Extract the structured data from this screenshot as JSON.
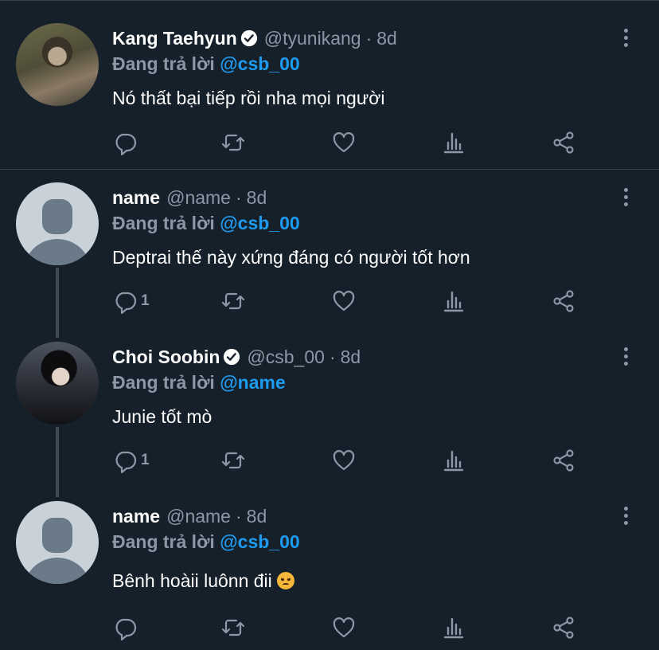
{
  "tweets": [
    {
      "name": "Kang Taehyun",
      "verified": true,
      "handle": "@tyunikang",
      "separator": "·",
      "time": "8d",
      "reply_label": "Đang trả lời",
      "reply_to": "@csb_00",
      "text": "Nó thất bại tiếp rồi nha mọi người",
      "reply_count": "",
      "avatar": "photo-avatar"
    },
    {
      "name": "name",
      "verified": false,
      "handle": "@name",
      "separator": "·",
      "time": "8d",
      "reply_label": "Đang trả lời",
      "reply_to": "@csb_00",
      "text": "Deptrai thế này xứng đáng có người tốt hơn",
      "reply_count": "1",
      "avatar": "default-avatar"
    },
    {
      "name": "Choi Soobin",
      "verified": true,
      "handle": "@csb_00",
      "separator": "·",
      "time": "8d",
      "reply_label": "Đang trả lời",
      "reply_to": "@name",
      "text": "Junie tốt mò",
      "reply_count": "1",
      "avatar": "photo-avatar"
    },
    {
      "name": "name",
      "verified": false,
      "handle": "@name",
      "separator": "·",
      "time": "8d",
      "reply_label": "Đang trả lời",
      "reply_to": "@csb_00",
      "text": "Bênh hoàii luônn đii",
      "emoji": "angry-face-emoji",
      "reply_count": "",
      "avatar": "default-avatar"
    }
  ],
  "icons": [
    "reply-icon",
    "retweet-icon",
    "like-icon",
    "analytics-icon",
    "share-icon",
    "more-icon",
    "verified-badge-icon"
  ],
  "colors": {
    "background": "#15202b",
    "accent": "#1d9bf0",
    "muted": "#8b98a5",
    "divider": "#38444d"
  }
}
